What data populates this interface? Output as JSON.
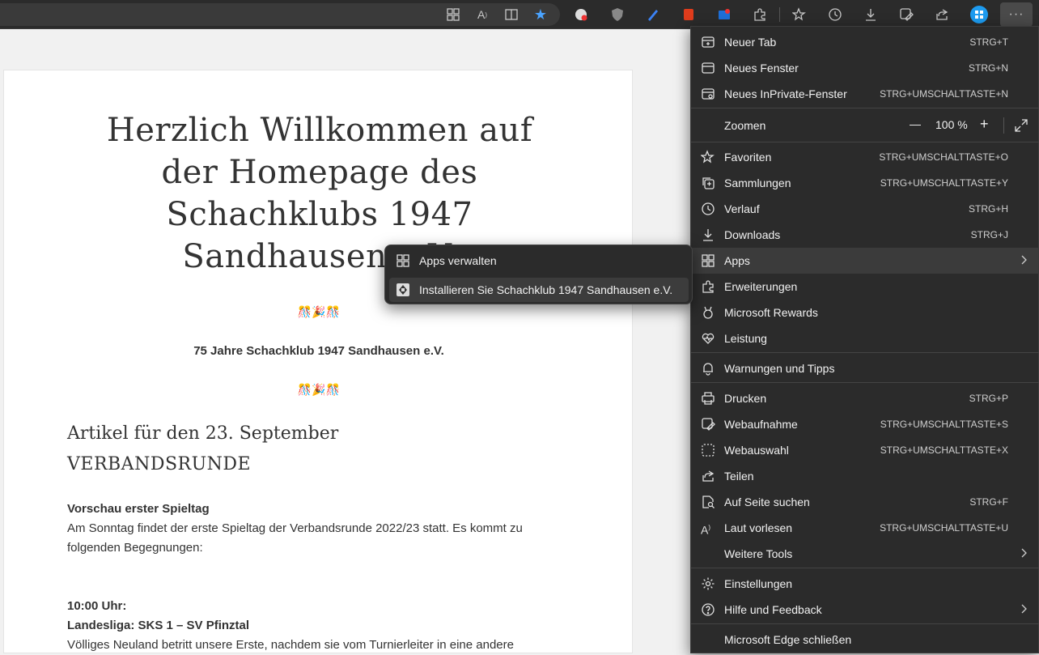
{
  "page": {
    "title_lines": [
      "Herzlich Willkommen auf",
      "der Homepage des",
      "Schachklubs 1947",
      "Sandhausen e.V."
    ],
    "emoji_top": "🎊🎉🎊",
    "anniversary": "75 Jahre Schachklub 1947 Sandhausen e.V.",
    "emoji_bottom": "🎊🎉🎊",
    "article_heading": "Artikel für den 23. September",
    "article_sub": "VERBANDSRUNDE",
    "preview_title": "Vorschau erster Spieltag",
    "preview_text_1": "Am Sonntag findet der erste Spieltag der Verbandsrunde 2022/23 statt. Es kommt zu",
    "preview_text_2": "folgenden Begegnungen:",
    "time": "10:00 Uhr:",
    "match": "Landesliga: SKS 1 – SV Pfinztal",
    "body_text": "Völliges Neuland betritt unsere Erste, nachdem sie vom Turnierleiter in eine andere"
  },
  "menu": {
    "new_tab": {
      "label": "Neuer Tab",
      "shortcut": "STRG+T"
    },
    "new_window": {
      "label": "Neues Fenster",
      "shortcut": "STRG+N"
    },
    "inprivate": {
      "label": "Neues InPrivate-Fenster",
      "shortcut": "STRG+UMSCHALTTASTE+N"
    },
    "zoom": {
      "label": "Zoomen",
      "value": "100 %",
      "minus": "—",
      "plus": "+"
    },
    "favorites": {
      "label": "Favoriten",
      "shortcut": "STRG+UMSCHALTTASTE+O"
    },
    "collections": {
      "label": "Sammlungen",
      "shortcut": "STRG+UMSCHALTTASTE+Y"
    },
    "history": {
      "label": "Verlauf",
      "shortcut": "STRG+H"
    },
    "downloads": {
      "label": "Downloads",
      "shortcut": "STRG+J"
    },
    "apps": {
      "label": "Apps"
    },
    "extensions": {
      "label": "Erweiterungen"
    },
    "rewards": {
      "label": "Microsoft Rewards"
    },
    "performance": {
      "label": "Leistung"
    },
    "alerts": {
      "label": "Warnungen und Tipps"
    },
    "print": {
      "label": "Drucken",
      "shortcut": "STRG+P"
    },
    "webcapture": {
      "label": "Webaufnahme",
      "shortcut": "STRG+UMSCHALTTASTE+S"
    },
    "webselect": {
      "label": "Webauswahl",
      "shortcut": "STRG+UMSCHALTTASTE+X"
    },
    "share": {
      "label": "Teilen"
    },
    "find": {
      "label": "Auf Seite suchen",
      "shortcut": "STRG+F"
    },
    "read_aloud": {
      "label": "Laut vorlesen",
      "shortcut": "STRG+UMSCHALTTASTE+U"
    },
    "more_tools": {
      "label": "Weitere Tools"
    },
    "settings": {
      "label": "Einstellungen"
    },
    "help": {
      "label": "Hilfe und Feedback"
    },
    "close": {
      "label": "Microsoft Edge schließen"
    }
  },
  "submenu": {
    "manage_apps": "Apps verwalten",
    "install": "Installieren Sie Schachklub 1947 Sandhausen e.V."
  },
  "colors": {
    "toolbar": "#2b2b2b",
    "menu": "#2b2b2b",
    "favorite_star": "#4aa3ff"
  }
}
